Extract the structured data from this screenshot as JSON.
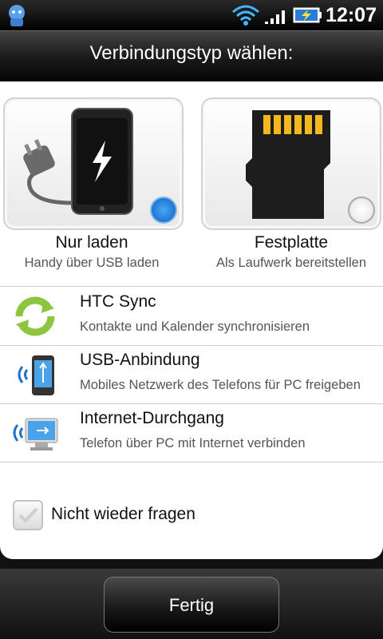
{
  "statusbar": {
    "time": "12:07",
    "icons": [
      "app-robot-icon",
      "wifi-icon",
      "signal-icon",
      "battery-charging-icon"
    ]
  },
  "dialog": {
    "title": "Verbindungstyp wählen:",
    "options": [
      {
        "title": "Nur laden",
        "subtitle": "Handy über USB laden",
        "selected": true,
        "icon": "charger-phone-icon"
      },
      {
        "title": "Festplatte",
        "subtitle": "Als Laufwerk bereitstellen",
        "selected": false,
        "icon": "sd-card-icon"
      }
    ],
    "list": [
      {
        "title": "HTC Sync",
        "subtitle": "Kontakte und Kalender synchronisieren",
        "icon": "sync-icon"
      },
      {
        "title": "USB-Anbindung",
        "subtitle": "Mobiles Netzwerk des Telefons für PC freigeben",
        "icon": "usb-tether-phone-icon"
      },
      {
        "title": "Internet-Durchgang",
        "subtitle": "Telefon über PC mit Internet verbinden",
        "icon": "usb-monitor-icon"
      }
    ],
    "checkbox_label": "Nicht wieder fragen",
    "checkbox_checked": false,
    "done_label": "Fertig"
  }
}
